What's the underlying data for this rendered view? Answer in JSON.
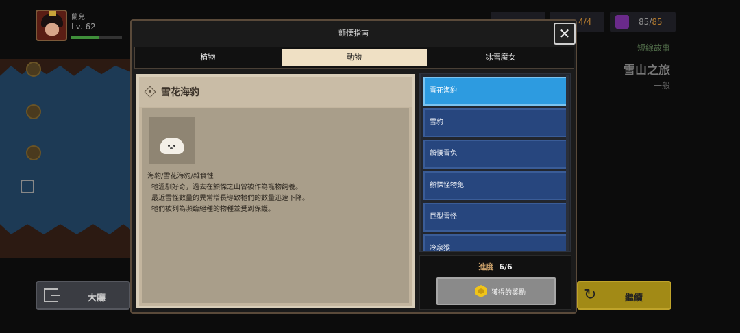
{
  "player": {
    "name": "蘭兒",
    "level": "Lv. 62",
    "exp_fraction": 0.55
  },
  "top_stats": {
    "stat_b": "4/4",
    "stat_c_current": "85",
    "stat_c_sep": "/",
    "stat_c_max": "85"
  },
  "story": {
    "type": "短線故事",
    "title": "雪山之旅",
    "difficulty": "一般"
  },
  "buttons": {
    "lobby": "大廳",
    "continue": "繼續"
  },
  "modal": {
    "title": "顫慄指南",
    "close_label": "✕",
    "tabs": [
      {
        "label": "植物"
      },
      {
        "label": "動物"
      },
      {
        "label": "冰雪魔女"
      }
    ],
    "active_tab": "動物",
    "detail": {
      "name": "雪花海豹",
      "desc_line1": "海豹/雪花海豹/雜食性",
      "desc_line2": "牠溫馴好奇，過去在顫慄之山曾被作為寵物飼養。",
      "desc_line3": "最近雪怪數量的異常增長導致牠們的數量迅速下降。",
      "desc_line4": "牠們被列為瀕臨絕種的物種並受到保護。"
    },
    "list": [
      {
        "label": "雪花海豹"
      },
      {
        "label": "雪豹"
      },
      {
        "label": "顫慄雪兔"
      },
      {
        "label": "顫慄怪物兔"
      },
      {
        "label": "巨型雪怪"
      },
      {
        "label": "冷泉猴"
      }
    ],
    "selected_item": "雪花海豹",
    "progress": {
      "label": "進度",
      "value": "6/6"
    },
    "reward_button": "獲得的獎勵"
  },
  "colors": {
    "accent_blue": "#2d9be0",
    "list_blue": "#27467e",
    "tab_active": "#efe0c4",
    "reward_gold": "#f0c419"
  }
}
